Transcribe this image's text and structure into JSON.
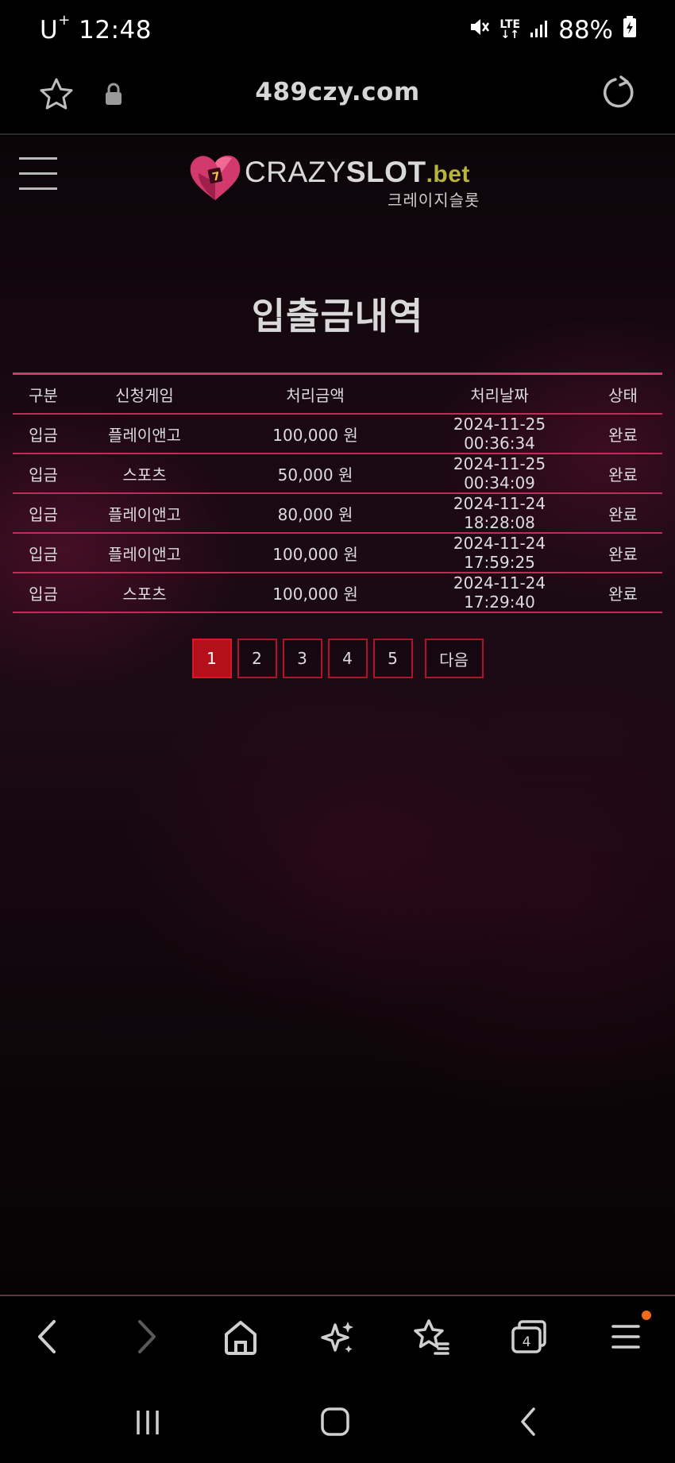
{
  "status_bar": {
    "carrier": "U",
    "carrier_sup": "+",
    "time": "12:48",
    "network": "LTE",
    "battery": "88%"
  },
  "browser": {
    "url": "489czy.com"
  },
  "site": {
    "logo_crazy": "CRAZY",
    "logo_slot": "SLOT",
    "logo_bet": ".bet",
    "logo_korean": "크레이지슬롯"
  },
  "page": {
    "title": "입출금내역"
  },
  "table": {
    "headers": [
      "구분",
      "신청게임",
      "처리금액",
      "처리날짜",
      "상태"
    ],
    "rows": [
      [
        "입금",
        "플레이앤고",
        "100,000 원",
        "2024-11-25 00:36:34",
        "완료"
      ],
      [
        "입금",
        "스포츠",
        "50,000 원",
        "2024-11-25 00:34:09",
        "완료"
      ],
      [
        "입금",
        "플레이앤고",
        "80,000 원",
        "2024-11-24 18:28:08",
        "완료"
      ],
      [
        "입금",
        "플레이앤고",
        "100,000 원",
        "2024-11-24 17:59:25",
        "완료"
      ],
      [
        "입금",
        "스포츠",
        "100,000 원",
        "2024-11-24 17:29:40",
        "완료"
      ]
    ]
  },
  "pagination": {
    "pages": [
      "1",
      "2",
      "3",
      "4",
      "5"
    ],
    "current": "1",
    "next_label": "다음"
  },
  "toolbar": {
    "tabs_count": "4"
  },
  "colors": {
    "accent": "#d8356a",
    "active_page": "#b50f1c",
    "notification_dot": "#f36a1e"
  }
}
